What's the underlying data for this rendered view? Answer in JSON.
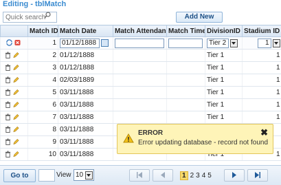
{
  "title": "Editing - tblMatch",
  "toolbar": {
    "search_placeholder": "Quick search",
    "add_new_label": "Add New"
  },
  "columns": [
    {
      "label": "",
      "required": ""
    },
    {
      "label": "Match ID",
      "required": ""
    },
    {
      "label": "Match Date",
      "required": ""
    },
    {
      "label": "Match Attendance",
      "required": ""
    },
    {
      "label": "Match Time",
      "required": ""
    },
    {
      "label": "DivisionID",
      "required": "*"
    },
    {
      "label": "Stadium ID",
      "required": "*"
    }
  ],
  "edit_row": {
    "match_id": "1",
    "match_date": "01/12/1888",
    "division": "Tier 2",
    "stadium": "1"
  },
  "rows": [
    {
      "match_id": "2",
      "match_date": "01/12/1888",
      "division": "Tier 1",
      "stadium": "1"
    },
    {
      "match_id": "3",
      "match_date": "01/12/1888",
      "division": "Tier 1",
      "stadium": "1"
    },
    {
      "match_id": "4",
      "match_date": "02/03/1889",
      "division": "Tier 1",
      "stadium": "1"
    },
    {
      "match_id": "5",
      "match_date": "03/11/1888",
      "division": "Tier 1",
      "stadium": "1"
    },
    {
      "match_id": "6",
      "match_date": "03/11/1888",
      "division": "Tier 1",
      "stadium": "1"
    },
    {
      "match_id": "7",
      "match_date": "03/11/1888",
      "division": "Tier 1",
      "stadium": "1"
    },
    {
      "match_id": "8",
      "match_date": "03/11/1888",
      "division": "",
      "stadium": ""
    },
    {
      "match_id": "9",
      "match_date": "03/11/1888",
      "division": "",
      "stadium": ""
    },
    {
      "match_id": "10",
      "match_date": "03/11/1888",
      "division": "Tier 1",
      "stadium": "1"
    }
  ],
  "pager": {
    "goto_label": "Go to",
    "view_label": "View",
    "view_value": "10",
    "current_page": "1",
    "pages": [
      "2",
      "3",
      "4",
      "5"
    ]
  },
  "error": {
    "title": "ERROR",
    "message": "Error updating database - record not found"
  },
  "colors": {
    "accent": "#3a8bd0",
    "error_bg": "#fef4b8",
    "required": "#d9342b",
    "current_page": "#f5d96b"
  },
  "icons": {
    "edit_row": [
      "save-icon",
      "cancel-icon",
      "calendar-icon"
    ],
    "data_row": [
      "delete-icon",
      "edit-icon"
    ],
    "error": [
      "warning-icon",
      "close-icon"
    ],
    "pager": [
      "first-page-icon",
      "prev-page-icon",
      "next-page-icon",
      "last-page-icon"
    ]
  }
}
